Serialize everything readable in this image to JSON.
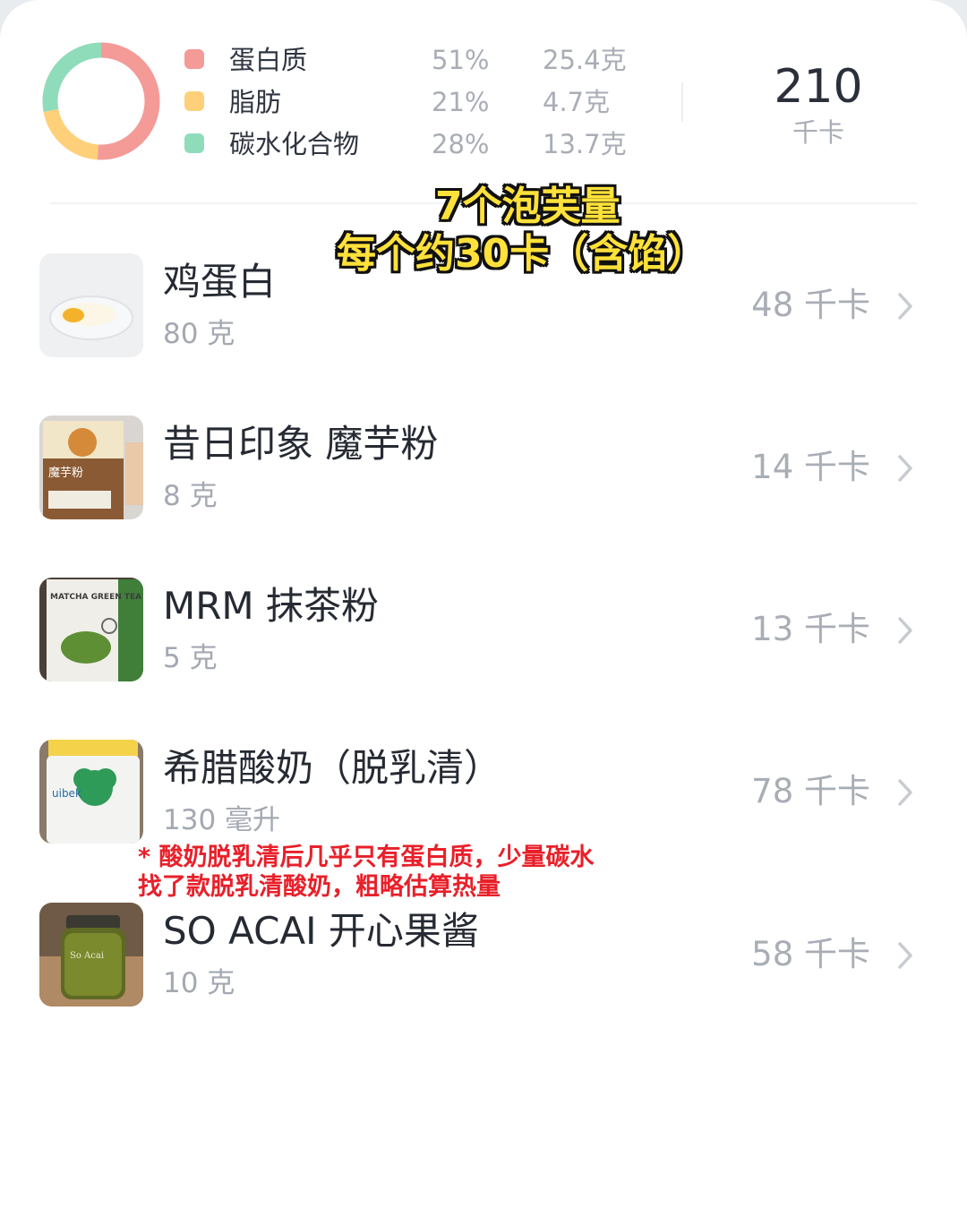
{
  "summary": {
    "macros": [
      {
        "name": "蛋白质",
        "pct": "51%",
        "amount": "25.4克",
        "color": "#f49a97"
      },
      {
        "name": "脂肪",
        "pct": "21%",
        "amount": "4.7克",
        "color": "#ffd07a"
      },
      {
        "name": "碳水化合物",
        "pct": "28%",
        "amount": "13.7克",
        "color": "#8fdcba"
      }
    ],
    "total_kcal": "210",
    "total_unit": "千卡"
  },
  "caption": {
    "line1": "7个泡芙量",
    "line2": "每个约30卡（含馅）"
  },
  "foods": [
    {
      "name": "鸡蛋白",
      "qty": "80 克",
      "kcal": "48 千卡"
    },
    {
      "name": "昔日印象 魔芋粉",
      "qty": "8 克",
      "kcal": "14 千卡"
    },
    {
      "name": "MRM 抹茶粉",
      "qty": "5 克",
      "kcal": "13 千卡"
    },
    {
      "name": "希腊酸奶（脱乳清）",
      "qty": "130 毫升",
      "kcal": "78 千卡"
    },
    {
      "name": "SO ACAI 开心果酱",
      "qty": "10 克",
      "kcal": "58 千卡"
    }
  ],
  "note": {
    "line1": "* 酸奶脱乳清后几乎只有蛋白质，少量碳水",
    "line2": "找了款脱乳清酸奶，粗略估算热量"
  },
  "thumb_text": {
    "konjac_label": "魔芋粉",
    "matcha_label": "MATCHA GREEN TEA POWDER",
    "yogurt_label": "uibek",
    "jar_label": "So Acai"
  }
}
